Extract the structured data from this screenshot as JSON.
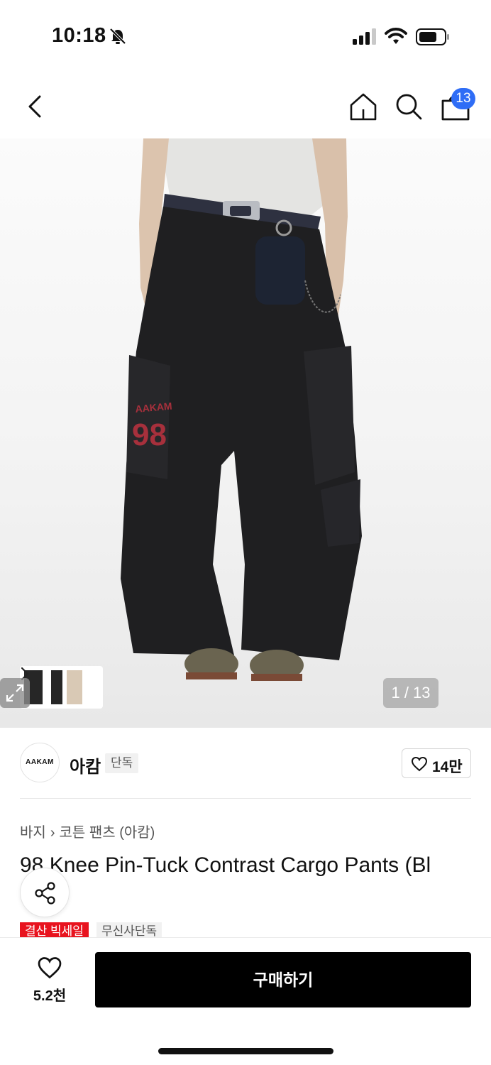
{
  "status_bar": {
    "time": "10:18"
  },
  "nav": {
    "cart_count": "13"
  },
  "gallery": {
    "counter": "1 / 13",
    "image": {
      "logo_small": "AAKAM",
      "logo_number": "98"
    }
  },
  "brand": {
    "logo_text": "AAKAM",
    "name": "아캄",
    "tag": "단독",
    "likes": "14만"
  },
  "breadcrumb": {
    "category": "바지",
    "subcategory": "코튼 팬츠 (아캄)"
  },
  "product": {
    "title": "98 Knee Pin-Tuck Contrast Cargo Pants (Bl",
    "tags": {
      "sale": "결산 빅세일",
      "exclusive": "무신사단독"
    }
  },
  "bottom_bar": {
    "wish_count": "5.2천",
    "buy_label": "구매하기"
  },
  "colors": {
    "accent_blue": "#2f6df6",
    "sale_red": "#e8131e",
    "buy_black": "#000000"
  }
}
